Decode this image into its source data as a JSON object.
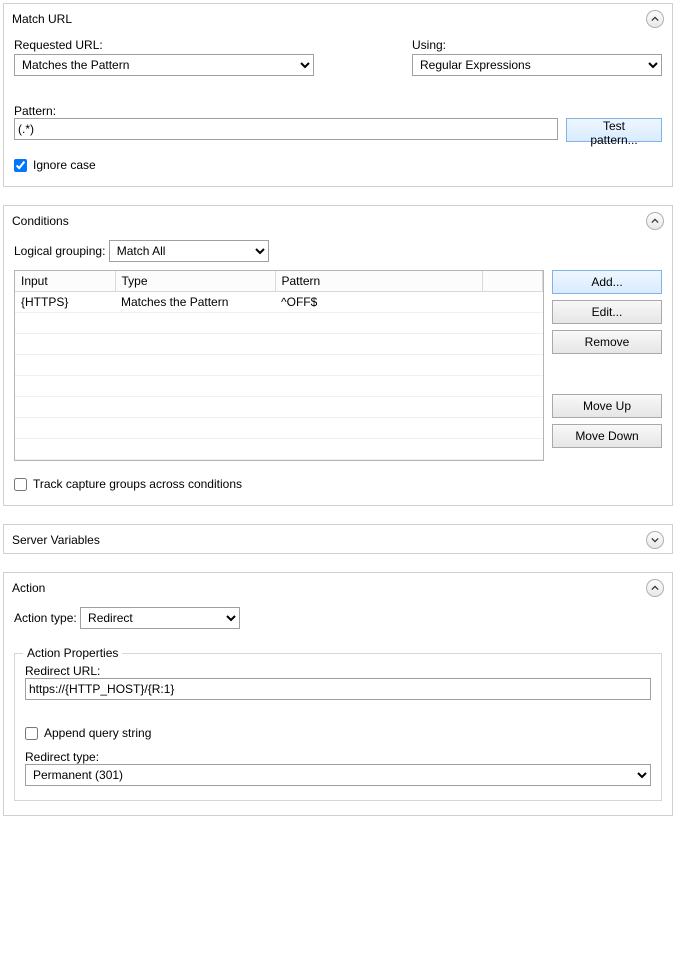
{
  "matchUrl": {
    "title": "Match URL",
    "requestedUrlLabel": "Requested URL:",
    "requestedUrlValue": "Matches the Pattern",
    "usingLabel": "Using:",
    "usingValue": "Regular Expressions",
    "patternLabel": "Pattern:",
    "patternValue": "(.*)",
    "testPatternLabel": "Test pattern...",
    "ignoreCaseLabel": "Ignore case",
    "ignoreCaseChecked": true
  },
  "conditions": {
    "title": "Conditions",
    "logicalGroupingLabel": "Logical grouping:",
    "logicalGroupingValue": "Match All",
    "columns": {
      "input": "Input",
      "type": "Type",
      "pattern": "Pattern"
    },
    "rows": [
      {
        "input": "{HTTPS}",
        "type": "Matches the Pattern",
        "pattern": "^OFF$"
      }
    ],
    "buttons": {
      "add": "Add...",
      "edit": "Edit...",
      "remove": "Remove",
      "moveUp": "Move Up",
      "moveDown": "Move Down"
    },
    "trackCaptureLabel": "Track capture groups across conditions",
    "trackCaptureChecked": false
  },
  "serverVariables": {
    "title": "Server Variables"
  },
  "action": {
    "title": "Action",
    "actionTypeLabel": "Action type:",
    "actionTypeValue": "Redirect",
    "propertiesLegend": "Action Properties",
    "redirectUrlLabel": "Redirect URL:",
    "redirectUrlValue": "https://{HTTP_HOST}/{R:1}",
    "appendQueryLabel": "Append query string",
    "appendQueryChecked": false,
    "redirectTypeLabel": "Redirect type:",
    "redirectTypeValue": "Permanent (301)"
  }
}
